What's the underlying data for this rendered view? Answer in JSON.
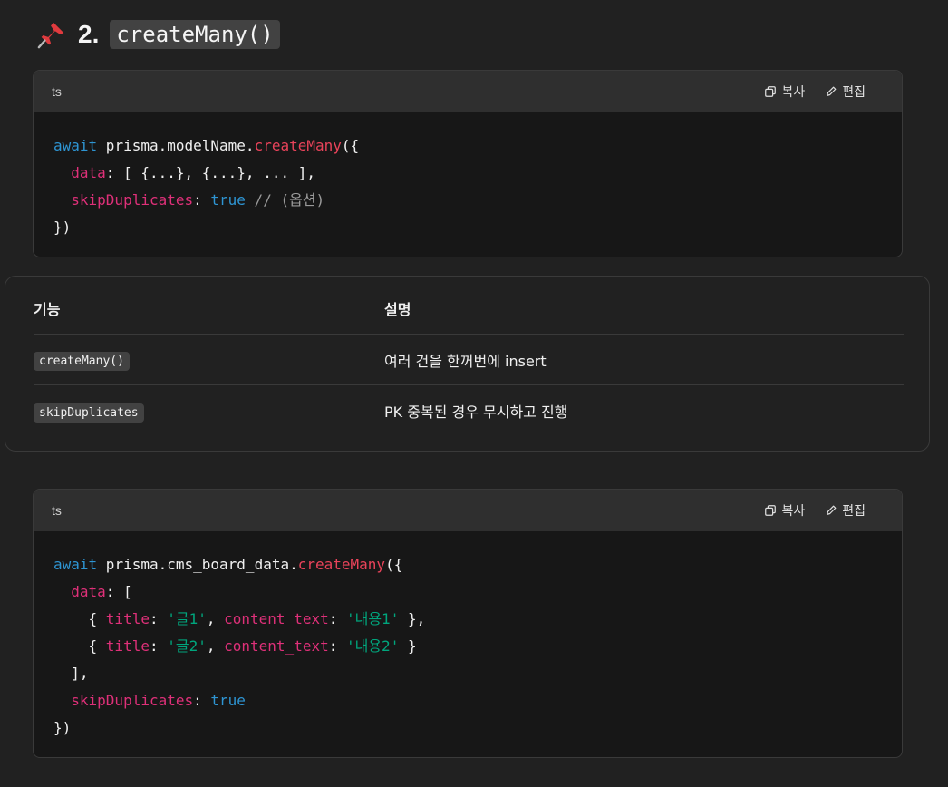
{
  "heading": {
    "number": "2.",
    "code": "createMany()"
  },
  "code_block_1": {
    "lang": "ts",
    "copy_label": "복사",
    "edit_label": "편집",
    "lines": {
      "l1_await": "await",
      "l1_obj": " prisma.modelName.",
      "l1_fn": "createMany",
      "l1_end": "({",
      "l2_indent": "  ",
      "l2_prop": "data",
      "l2_rest": ": [ {...}, {...}, ... ],",
      "l3_indent": "  ",
      "l3_prop": "skipDuplicates",
      "l3_colon": ": ",
      "l3_bool": "true",
      "l3_cmt": " // (옵션)",
      "l4": "})"
    }
  },
  "table": {
    "headers": [
      "기능",
      "설명"
    ],
    "rows": [
      {
        "feature": "createMany()",
        "desc": "여러 건을 한꺼번에 insert"
      },
      {
        "feature": "skipDuplicates",
        "desc": "PK 중복된 경우 무시하고 진행"
      }
    ]
  },
  "code_block_2": {
    "lang": "ts",
    "copy_label": "복사",
    "edit_label": "편집",
    "lines": {
      "l1_await": "await",
      "l1_obj": " prisma.cms_board_data.",
      "l1_fn": "createMany",
      "l1_end": "({",
      "l2_indent": "  ",
      "l2_prop": "data",
      "l2_rest": ": [",
      "l3_open": "    { ",
      "l3_title": "title",
      "l3_c1": ": ",
      "l3_s1": "'글1'",
      "l3_comma": ", ",
      "l3_ct": "content_text",
      "l3_c2": ": ",
      "l3_s2": "'내용1'",
      "l3_close": " },",
      "l4_open": "    { ",
      "l4_title": "title",
      "l4_c1": ": ",
      "l4_s1": "'글2'",
      "l4_comma": ", ",
      "l4_ct": "content_text",
      "l4_c2": ": ",
      "l4_s2": "'내용2'",
      "l4_close": " }",
      "l5": "  ],",
      "l6_indent": "  ",
      "l6_prop": "skipDuplicates",
      "l6_colon": ": ",
      "l6_bool": "true",
      "l7": "})"
    }
  }
}
